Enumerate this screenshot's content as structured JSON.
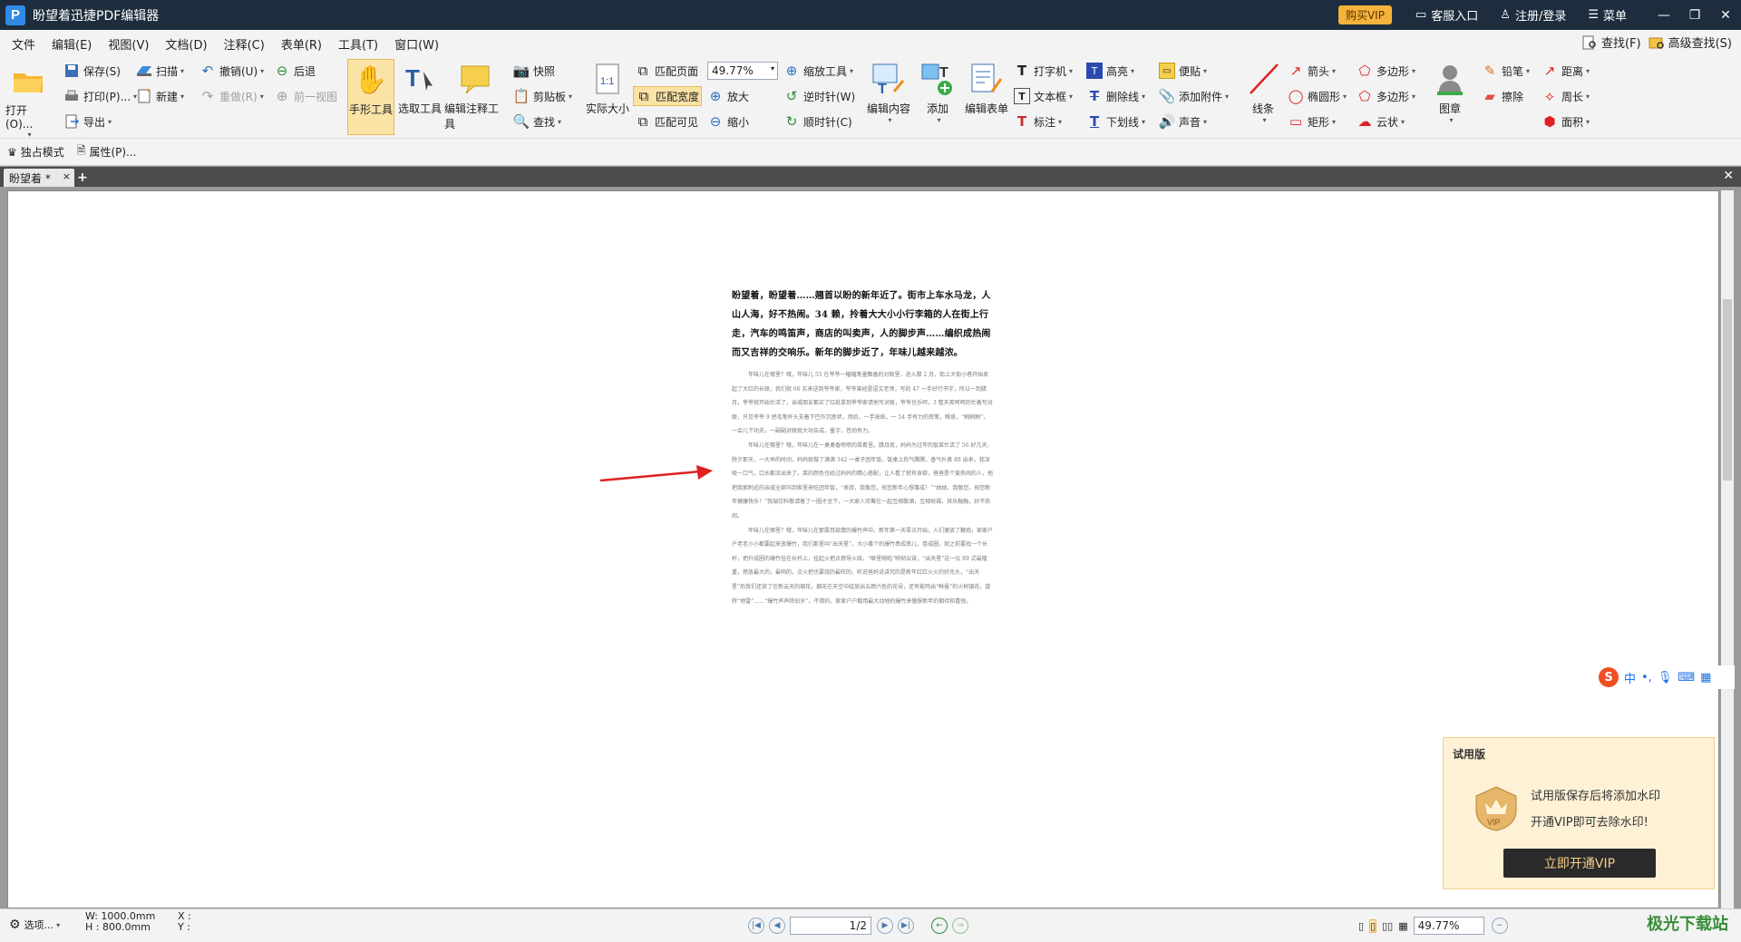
{
  "app": {
    "title": "盼望着迅捷PDF编辑器",
    "logo_letter": "P",
    "vip_label": "购买VIP",
    "service_label": "客服入口",
    "login_label": "注册/登录",
    "menu_label": "菜单"
  },
  "menubar": {
    "items": [
      "文件",
      "编辑(E)",
      "视图(V)",
      "文档(D)",
      "注释(C)",
      "表单(R)",
      "工具(T)",
      "窗口(W)"
    ],
    "search_label": "查找(F)",
    "advanced_search_label": "高级查找(S)"
  },
  "ribbon": {
    "open": "打开(O)...",
    "save": "保存(S)",
    "print": "打印(P)...",
    "export": "导出",
    "scan": "扫描",
    "new": "新建",
    "undo": "撤销(U)",
    "redo": "重做(R)",
    "back": "后退",
    "forward_view": "前一视图",
    "hand_tool": "手形工具",
    "select_tool": "选取工具",
    "annot_tool": "编辑注释工具",
    "snapshot": "快照",
    "clipboard": "剪贴板",
    "find": "查找",
    "actual_size": "实际大小",
    "fit_page": "匹配页面",
    "fit_width": "匹配宽度",
    "fit_visible": "匹配可见",
    "zoom_value": "49.77%",
    "zoom_tool": "缩放工具",
    "zoom_in": "放大",
    "zoom_out": "缩小",
    "rotate_ccw": "逆时针(W)",
    "rotate_cw": "顺时针(C)",
    "edit_content": "编辑内容",
    "add": "添加",
    "edit_form": "编辑表单",
    "typewriter": "打字机",
    "textbox": "文本框",
    "callout": "标注",
    "highlight": "高亮",
    "strikeout": "删除线",
    "underline": "下划线",
    "note": "便贴",
    "attach": "添加附件",
    "sound": "声音",
    "line": "线条",
    "arrow": "箭头",
    "ellipse": "椭圆形",
    "rect": "矩形",
    "polygon1": "多边形",
    "polygon2": "多边形",
    "cloud": "云状",
    "stamp": "图章",
    "pencil": "铅笔",
    "eraser": "擦除",
    "distance": "距离",
    "perimeter": "周长",
    "area": "面积"
  },
  "subbar": {
    "exclusive_mode": "独占模式",
    "properties": "属性(P)..."
  },
  "tabs": {
    "doc_tab": "盼望着 *",
    "close": "×",
    "add": "+"
  },
  "document": {
    "title_para": "盼望着，盼望着……翘首以盼的新年近了。街市上车水马龙，人山人海，好不热闹。34 赖，拎着大大小小行李箱的人在街上行走，汽车的鸣笛声，商店的叫卖声，人的脚步声……编织成热闹而又吉祥的交响乐。新年的脚步近了，年味儿越来越浓。",
    "body_paras": [
      "年味儿在哪里？哦，年味儿 55 在爷爷一幅幅笔墨飘香的对联里，进入腊 2 月，街上大街小巷开始卖起了大红的长联，我们就 66 买来送到爷爷家，爷爷曾经是语文老师，写的 47 一手好行书字，所以一到腊月，爷爷就开始忙活了，亲戚朋友都买了红纸拿到爷爷家请他写对联，爷爷也乐呵，3 整天笑呵呵的忙着写对联，只见爷爷 9 把毛笔杆头支着下巴作沉思状，然后，一手按纸，一 54 手有力的挥笔，瞬息，“刷刷刷”，一会儿下功夫，一副副对联就大功告成，墨字，苍劲有力。",
      "年味儿在哪里？哦，年味儿在一桌桌香喷喷的菜肴里。腊月底，妈妈为过年的饭菜忙活了 56 好几天，除夕那天，一大早的时间，妈妈就做了满满 342 一桌子团年饭，饭桌上热气腾腾，香气扑鼻 88 出来，我深吸一口气，口水都流出来了。菜的颜色也经过妈妈的精心搭配，让人看了就有食欲，爸爸是个爱热闹的人，他把我家附近的亲戚全部叫到家里来吃团年饭，“表叔，我敬您，祝您新年心想事成！”“姑姑，我敬您，祝您新年健康快乐！”我端饮料敬请着了一圈才坐下，一大家人欢聚在一起互相敬酒，互相祝福，其乐融融，好不热闹。",
      "年味儿在哪里？哦，年味儿在那震耳欲聋的爆竹声中。新年第一天零点开始，人们便放了鞭炮，家家户户老老小小都要起来放爆竹，我们那里叫“出天星”，大小事个的爆竹串成串儿，卷成圈，就之前要找一个长杆，把升成圈的爆竹挂在长杆上，挂起火把点燃导火线，“噼里啪啦”响彻云霄，“出天星”这一仪 89 式最隆重，燃放最大的，最响的，点火把也要烧的最旺的，听说爸妈说讲究的是新年红红火火的好兆头，“出天星”后我们还放了在新云天的烟花，烟花在天空中绽放出五颜六色的花朵，还有能鸣出“咻曼”的火树银花，旋转“地雷”……“爆竹声声除旧岁”，不错的，家家户户都用最大动地的爆竹来憧憬新年的期待和喜悦。"
    ]
  },
  "trial": {
    "head": "试用版",
    "line1": "试用版保存后将添加水印",
    "line2": "开通VIP即可去除水印!",
    "button": "立即开通VIP",
    "badge_text": "VIP"
  },
  "ime": {
    "logo": "S",
    "mode": "中"
  },
  "status": {
    "options": "选项...",
    "width": "W: 1000.0mm",
    "height": "H : 800.0mm",
    "x": "X :",
    "y": "Y :",
    "page_value": "1",
    "page_total": "2",
    "zoom_value": "49.77%",
    "watermark": "极光下载站"
  },
  "colors": {
    "titlebar": "#1e2d3d",
    "accent": "#2f8be6",
    "vip": "#f6b33c",
    "arrow": "#e02020"
  }
}
